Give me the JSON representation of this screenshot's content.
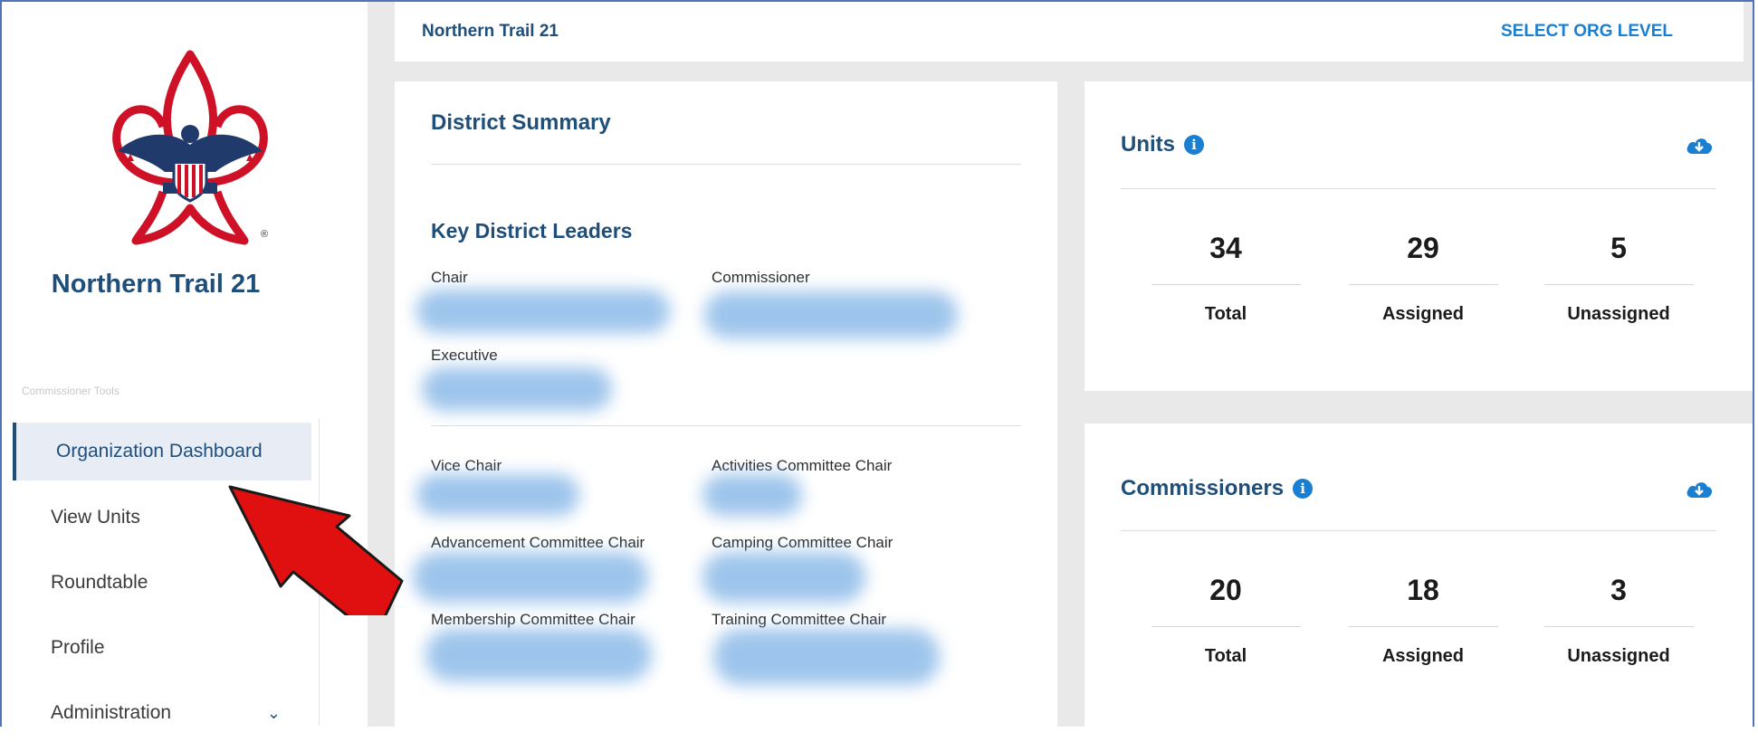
{
  "sidebar": {
    "org_name": "Northern Trail 21",
    "tools_label": "Commissioner Tools",
    "nav": [
      {
        "label": "Organization Dashboard",
        "active": true
      },
      {
        "label": "View Units"
      },
      {
        "label": "Roundtable"
      },
      {
        "label": "Profile"
      },
      {
        "label": "Administration",
        "expandable": true
      }
    ]
  },
  "topbar": {
    "title": "Northern Trail 21",
    "select_org_level": "SELECT ORG LEVEL"
  },
  "summary": {
    "title": "District Summary",
    "key_leaders_title": "Key District Leaders",
    "roles": {
      "chair": "Chair",
      "commissioner": "Commissioner",
      "executive": "Executive",
      "vice_chair": "Vice Chair",
      "activities": "Activities Committee Chair",
      "advancement": "Advancement Committee Chair",
      "camping": "Camping Committee Chair",
      "membership": "Membership Committee Chair",
      "training": "Training Committee Chair"
    }
  },
  "units": {
    "title": "Units",
    "total": "34",
    "assigned": "29",
    "unassigned": "5",
    "labels": {
      "total": "Total",
      "assigned": "Assigned",
      "unassigned": "Unassigned"
    }
  },
  "commissioners": {
    "title": "Commissioners",
    "total": "20",
    "assigned": "18",
    "unassigned": "3",
    "labels": {
      "total": "Total",
      "assigned": "Assigned",
      "unassigned": "Unassigned"
    }
  },
  "icons": {
    "info": "info-icon",
    "download": "cloud-download-icon",
    "chevron": "chevron-down-icon",
    "annotation": "red-arrow"
  },
  "colors": {
    "brand_blue": "#1f4e79",
    "link_blue": "#1a7fd0",
    "annotation_red": "#e01010",
    "frame_border": "#4f74b8"
  }
}
